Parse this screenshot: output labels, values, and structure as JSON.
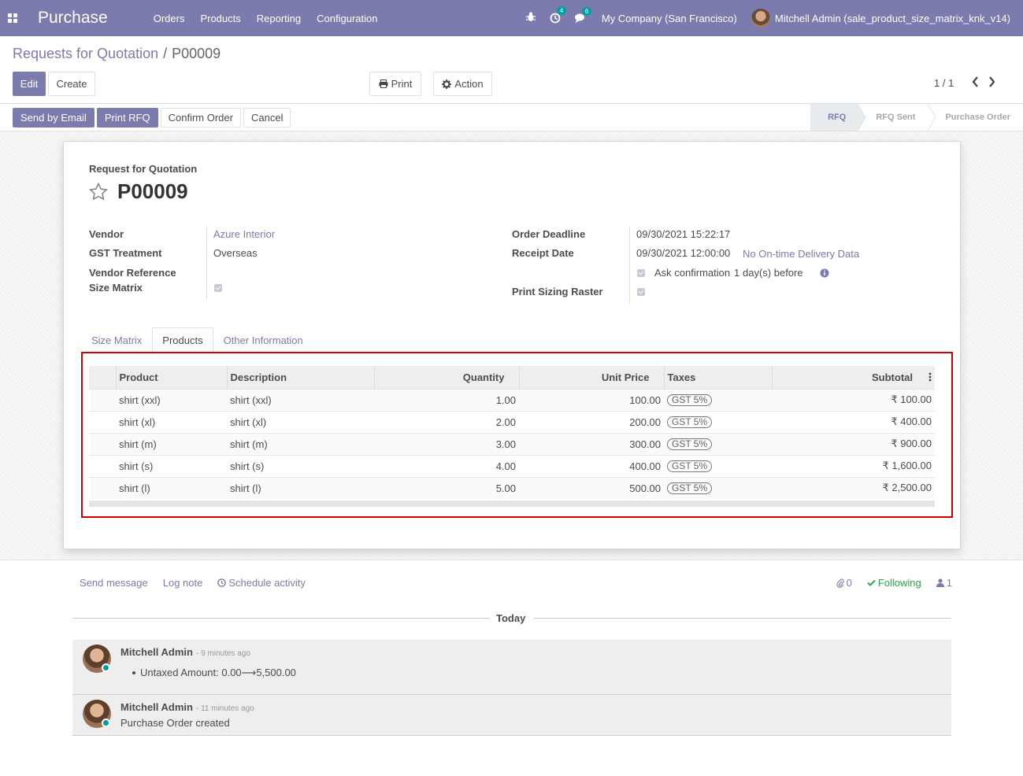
{
  "navbar": {
    "brand": "Purchase",
    "menu": [
      "Orders",
      "Products",
      "Reporting",
      "Configuration"
    ],
    "activity_count": "4",
    "message_count": "6",
    "company": "My Company (San Francisco)",
    "user": "Mitchell Admin (sale_product_size_matrix_knk_v14)"
  },
  "breadcrumb": {
    "parent": "Requests for Quotation",
    "sep": "/",
    "current": "P00009"
  },
  "control": {
    "edit": "Edit",
    "create": "Create",
    "print": "Print",
    "action": "Action",
    "pager": "1 / 1"
  },
  "status_buttons": [
    "Send by Email",
    "Print RFQ",
    "Confirm Order",
    "Cancel"
  ],
  "stages": [
    {
      "label": "RFQ",
      "active": true
    },
    {
      "label": "RFQ Sent",
      "active": false
    },
    {
      "label": "Purchase Order",
      "active": false
    }
  ],
  "form": {
    "doc_label": "Request for Quotation",
    "name": "P00009",
    "vendor_label": "Vendor",
    "vendor": "Azure Interior",
    "gst_label": "GST Treatment",
    "gst": "Overseas",
    "vendor_ref_label": "Vendor Reference",
    "size_matrix_label": "Size Matrix",
    "deadline_label": "Order Deadline",
    "deadline": "09/30/2021 15:22:17",
    "receipt_label": "Receipt Date",
    "receipt": "09/30/2021 12:00:00",
    "delivery_link": "No On-time Delivery Data",
    "ask_confirm": "Ask confirmation",
    "ask_days": "1",
    "ask_suffix": "day(s) before",
    "print_raster_label": "Print Sizing Raster"
  },
  "tabs": [
    {
      "label": "Size Matrix",
      "active": false
    },
    {
      "label": "Products",
      "active": true
    },
    {
      "label": "Other Information",
      "active": false
    }
  ],
  "table": {
    "headers": {
      "product": "Product",
      "description": "Description",
      "quantity": "Quantity",
      "unit_price": "Unit Price",
      "taxes": "Taxes",
      "subtotal": "Subtotal"
    },
    "rows": [
      {
        "product": "shirt (xxl)",
        "description": "shirt (xxl)",
        "quantity": "1.00",
        "unit_price": "100.00",
        "tax": "GST 5%",
        "subtotal": "₹ 100.00"
      },
      {
        "product": "shirt (xl)",
        "description": "shirt (xl)",
        "quantity": "2.00",
        "unit_price": "200.00",
        "tax": "GST 5%",
        "subtotal": "₹ 400.00"
      },
      {
        "product": "shirt (m)",
        "description": "shirt (m)",
        "quantity": "3.00",
        "unit_price": "300.00",
        "tax": "GST 5%",
        "subtotal": "₹ 900.00"
      },
      {
        "product": "shirt (s)",
        "description": "shirt (s)",
        "quantity": "4.00",
        "unit_price": "400.00",
        "tax": "GST 5%",
        "subtotal": "₹ 1,600.00"
      },
      {
        "product": "shirt (l)",
        "description": "shirt (l)",
        "quantity": "5.00",
        "unit_price": "500.00",
        "tax": "GST 5%",
        "subtotal": "₹ 2,500.00"
      }
    ]
  },
  "chatter": {
    "send_message": "Send message",
    "log_note": "Log note",
    "schedule_activity": "Schedule activity",
    "attachments": "0",
    "following": "Following",
    "followers": "1",
    "today": "Today",
    "messages": [
      {
        "author": "Mitchell Admin",
        "time": "- 9 minutes ago",
        "body_label": "Untaxed Amount:",
        "old": "0.00",
        "arrow": "⟶",
        "new": "5,500.00"
      },
      {
        "author": "Mitchell Admin",
        "time": "- 11 minutes ago",
        "body": "Purchase Order created"
      }
    ]
  },
  "colors": {
    "primary": "#7c7bad",
    "highlight": "#d00000",
    "online": "#00a09d",
    "following": "#28a745"
  }
}
